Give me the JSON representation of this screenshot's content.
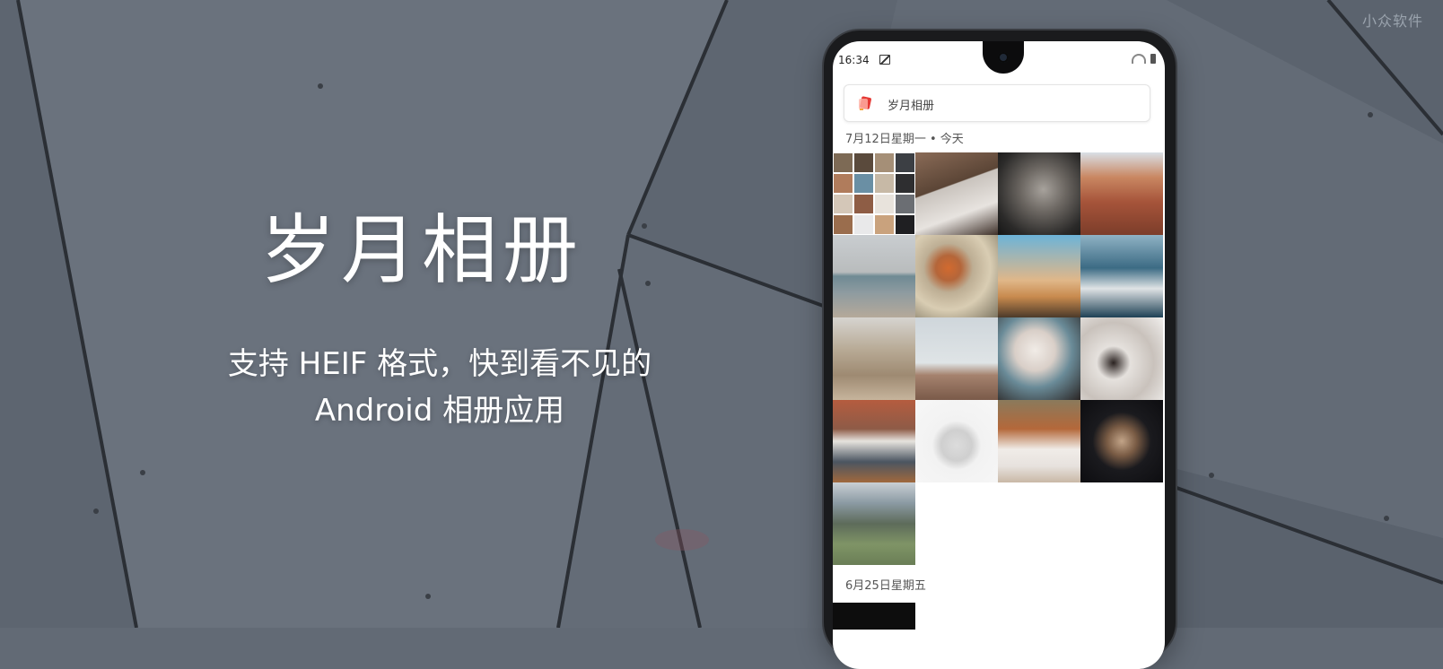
{
  "watermark": "小众软件",
  "hero": {
    "title": "岁月相册",
    "subtitle_line1": "支持 HEIF 格式，快到看不见的",
    "subtitle_line2": "Android 相册应用"
  },
  "phone": {
    "status_bar": {
      "time": "16:34"
    },
    "search_bar": {
      "label": "岁月相册",
      "app_icon": "photo-album-icon"
    },
    "sections": [
      {
        "date_label": "7月12日星期一 • 今天"
      },
      {
        "date_label": "6月25日星期五"
      }
    ]
  },
  "colors": {
    "background": "#626a75",
    "text_white": "#ffffff",
    "app_accent": "#e53935"
  }
}
